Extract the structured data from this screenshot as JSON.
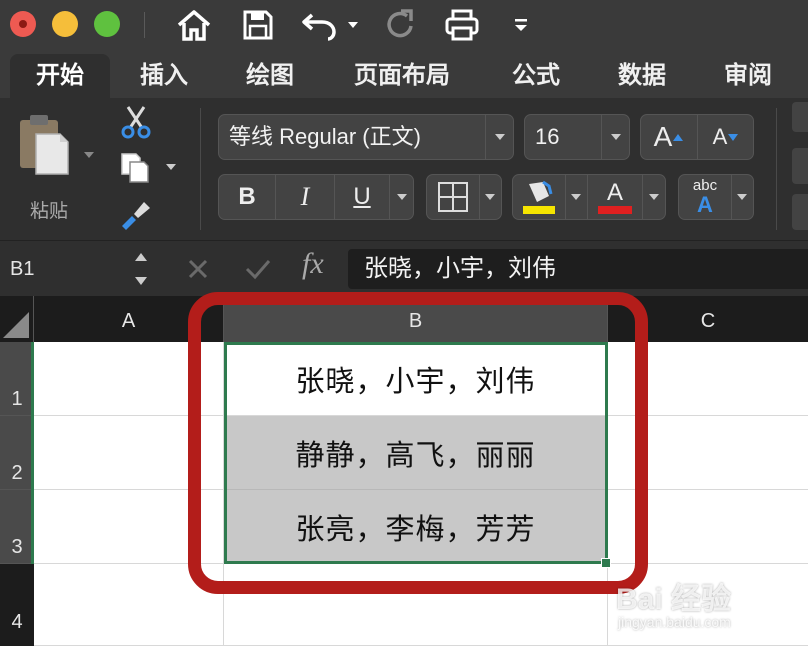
{
  "ribbon": {
    "tabs": [
      "开始",
      "插入",
      "绘图",
      "页面布局",
      "公式",
      "数据",
      "审阅"
    ],
    "paste_label": "粘贴",
    "font_name": "等线 Regular (正文)",
    "font_size": "16",
    "format": {
      "bold": "B",
      "italic": "I",
      "underline": "U",
      "font_color_letter": "A",
      "grow_font": "A",
      "shrink_font": "A",
      "abc_label": "abc",
      "abc_letter": "A"
    },
    "colors": {
      "highlight": "#f6e500",
      "font_color": "#e02020",
      "accent_blue": "#3a8ee6"
    }
  },
  "formula_bar": {
    "name_box": "B1",
    "fx_label": "fx",
    "formula": "张晓，小宇，刘伟"
  },
  "sheet": {
    "columns": [
      "A",
      "B",
      "C"
    ],
    "rows": [
      "1",
      "2",
      "3",
      "4"
    ],
    "cells": {
      "B1": "张晓，小宇，刘伟",
      "B2": "静静，高飞，丽丽",
      "B3": "张亮，李梅，芳芳"
    }
  },
  "watermark": {
    "brand": "Bai 经验",
    "site": "jingyan.baidu.com"
  }
}
